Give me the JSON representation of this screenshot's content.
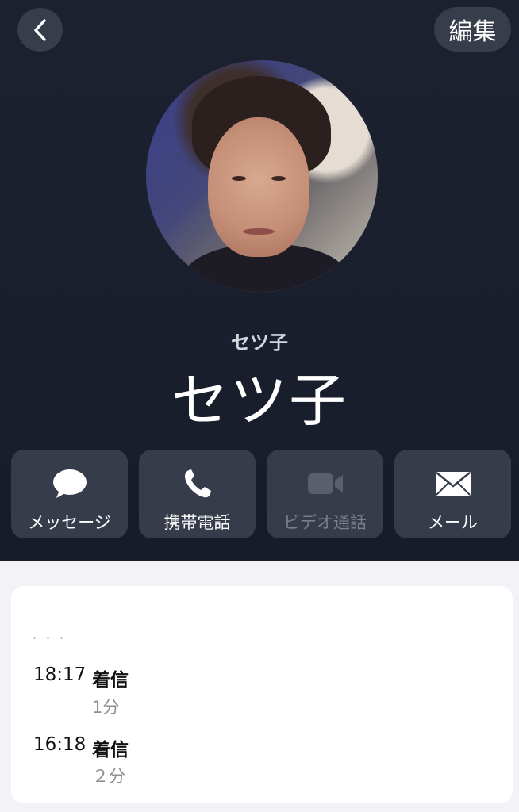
{
  "header": {
    "edit_label": "編集"
  },
  "contact": {
    "subtitle": "セツ子",
    "name": "セツ子"
  },
  "actions": [
    {
      "label": "メッセージ",
      "icon": "message-bubble-icon",
      "enabled": true
    },
    {
      "label": "携帯電話",
      "icon": "phone-icon",
      "enabled": true
    },
    {
      "label": "ビデオ通話",
      "icon": "video-camera-icon",
      "enabled": false
    },
    {
      "label": "メール",
      "icon": "envelope-icon",
      "enabled": true
    }
  ],
  "call_log": [
    {
      "time": "18:17",
      "type": "着信",
      "duration": "1分"
    },
    {
      "time": "16:18",
      "type": "着信",
      "duration": "２分"
    }
  ],
  "colors": {
    "header_bg": "#1c2130",
    "button_bg": "#373c4b",
    "disabled_text": "#7b7f8b",
    "page_bg": "#f2f2f7",
    "card_bg": "#ffffff"
  }
}
